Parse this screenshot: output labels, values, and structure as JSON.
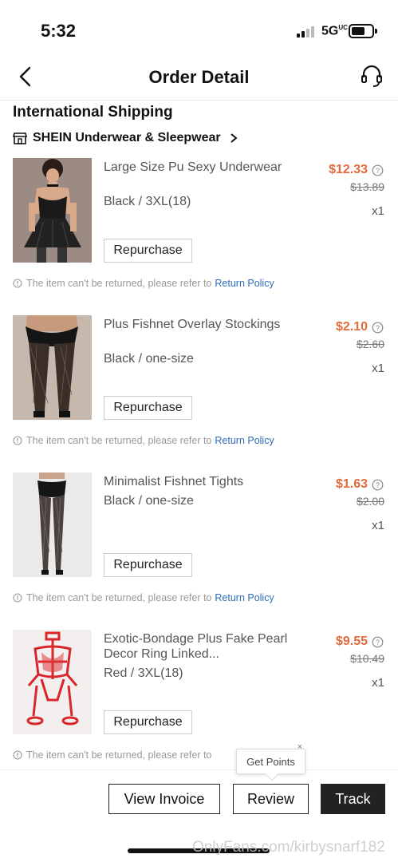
{
  "status_bar": {
    "time": "5:32",
    "network": "5G",
    "network_sup": "UC"
  },
  "header": {
    "title": "Order Detail"
  },
  "section_title": "International Shipping",
  "store": {
    "name": "SHEIN Underwear & Sleepwear"
  },
  "items": [
    {
      "name": "Large Size Pu Sexy Underwear",
      "variant": "Black / 3XL(18)",
      "price": "$12.33",
      "original_price": "$13.89",
      "qty": "x1",
      "button": "Repurchase",
      "notice": "The item can't be returned, please refer to",
      "policy_link": "Return Policy"
    },
    {
      "name": "Plus Fishnet Overlay Stockings",
      "variant": "Black / one-size",
      "price": "$2.10",
      "original_price": "$2.60",
      "qty": "x1",
      "button": "Repurchase",
      "notice": "The item can't be returned, please refer to",
      "policy_link": "Return Policy"
    },
    {
      "name": "Minimalist Fishnet Tights",
      "variant": "Black / one-size",
      "price": "$1.63",
      "original_price": "$2.00",
      "qty": "x1",
      "button": "Repurchase",
      "notice": "The item can't be returned, please refer to",
      "policy_link": "Return Policy"
    },
    {
      "name": "Exotic-Bondage Plus Fake Pearl Decor Ring Linked...",
      "variant": "Red / 3XL(18)",
      "price": "$9.55",
      "original_price": "$10.49",
      "qty": "x1",
      "button": "Repurchase",
      "notice": "The item can't be returned, please refer to",
      "policy_link": ""
    }
  ],
  "bottom_bar": {
    "view_invoice": "View Invoice",
    "review": "Review",
    "track": "Track",
    "tooltip": "Get Points",
    "tooltip_close": "×"
  },
  "watermark": "OnlyFans.com/kirbysnarf182",
  "colors": {
    "price": "#e36a3a",
    "link": "#2f6db5",
    "primary_button": "#222222"
  }
}
